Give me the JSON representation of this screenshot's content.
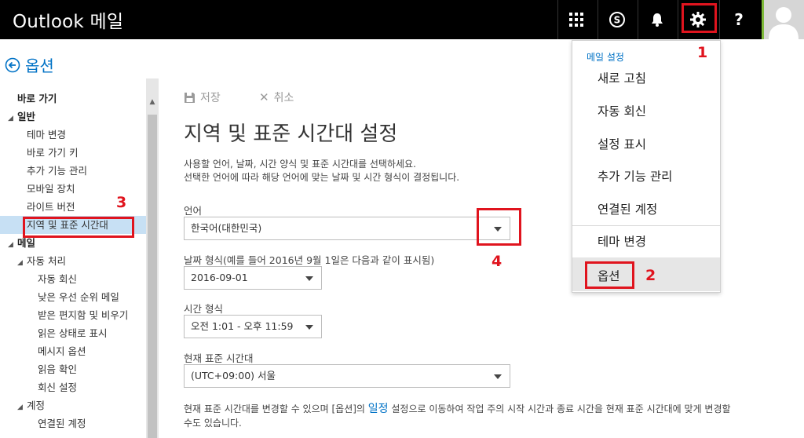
{
  "app_title": "Outlook 메일",
  "topbar": {
    "icons": [
      "app-launcher-icon",
      "skype-icon",
      "bell-icon",
      "gear-icon",
      "help-icon",
      "avatar"
    ],
    "help_label": "?"
  },
  "back": {
    "label": "옵션"
  },
  "sidebar": {
    "items": [
      {
        "label": "바로 가기",
        "bold": true,
        "indent": 0,
        "caret": false
      },
      {
        "label": "일반",
        "bold": true,
        "indent": 0,
        "caret": true
      },
      {
        "label": "테마 변경",
        "bold": false,
        "indent": 1,
        "caret": false
      },
      {
        "label": "바로 가기 키",
        "bold": false,
        "indent": 1,
        "caret": false
      },
      {
        "label": "추가 기능 관리",
        "bold": false,
        "indent": 1,
        "caret": false
      },
      {
        "label": "모바일 장치",
        "bold": false,
        "indent": 1,
        "caret": false
      },
      {
        "label": "라이트 버전",
        "bold": false,
        "indent": 1,
        "caret": false
      },
      {
        "label": "지역 및 표준 시간대",
        "bold": false,
        "indent": 1,
        "caret": false,
        "selected": true
      },
      {
        "label": "메일",
        "bold": true,
        "indent": 0,
        "caret": true
      },
      {
        "label": "자동 처리",
        "bold": false,
        "indent": 1,
        "caret": true
      },
      {
        "label": "자동 회신",
        "bold": false,
        "indent": 2,
        "caret": false
      },
      {
        "label": "낮은 우선 순위 메일",
        "bold": false,
        "indent": 2,
        "caret": false
      },
      {
        "label": "받은 편지함 및 비우기",
        "bold": false,
        "indent": 2,
        "caret": false
      },
      {
        "label": "읽은 상태로 표시",
        "bold": false,
        "indent": 2,
        "caret": false
      },
      {
        "label": "메시지 옵션",
        "bold": false,
        "indent": 2,
        "caret": false
      },
      {
        "label": "읽음 확인",
        "bold": false,
        "indent": 2,
        "caret": false
      },
      {
        "label": "회신 설정",
        "bold": false,
        "indent": 2,
        "caret": false
      },
      {
        "label": "계정",
        "bold": false,
        "indent": 1,
        "caret": true
      },
      {
        "label": "연결된 계정",
        "bold": false,
        "indent": 2,
        "caret": false
      }
    ]
  },
  "toolbar": {
    "save_label": "저장",
    "cancel_label": "취소"
  },
  "main": {
    "title": "지역 및 표준 시간대 설정",
    "desc_line1": "사용할 언어, 날짜, 시간 양식 및 표준 시간대를 선택하세요.",
    "desc_line2": "선택한 언어에 따라 해당 언어에 맞는 날짜 및 시간 형식이 결정됩니다.",
    "language_label": "언어",
    "language_value": "한국어(대한민국)",
    "date_label": "날짜 형식(예를 들어 2016년 9월 1일은 다음과 같이 표시됨)",
    "date_value": "2016-09-01",
    "time_label": "시간 형식",
    "time_value": "오전 1:01 - 오후 11:59",
    "tz_label": "현재 표준 시간대",
    "tz_value": "(UTC+09:00) 서울",
    "footer_before": "현재 표준 시간대를 변경할 수 있으며 [옵션]의 ",
    "footer_link": "일정",
    "footer_after": " 설정으로 이동하여 작업 주의 시작 시간과 종료 시간을 현재 표준 시간대에 맞게 변경할",
    "footer_line2": "수도 있습니다."
  },
  "menu": {
    "header": "메일 설정",
    "items": [
      "새로 고침",
      "자동 회신",
      "설정 표시",
      "추가 기능 관리",
      "연결된 계정",
      "테마 변경",
      "옵션"
    ]
  },
  "annotations": {
    "n1": "1",
    "n2": "2",
    "n3": "3",
    "n4": "4"
  },
  "colors": {
    "accent": "#0072c6",
    "annotation": "#e0141e",
    "topbar": "#000000",
    "selected": "#c7e0f4"
  }
}
